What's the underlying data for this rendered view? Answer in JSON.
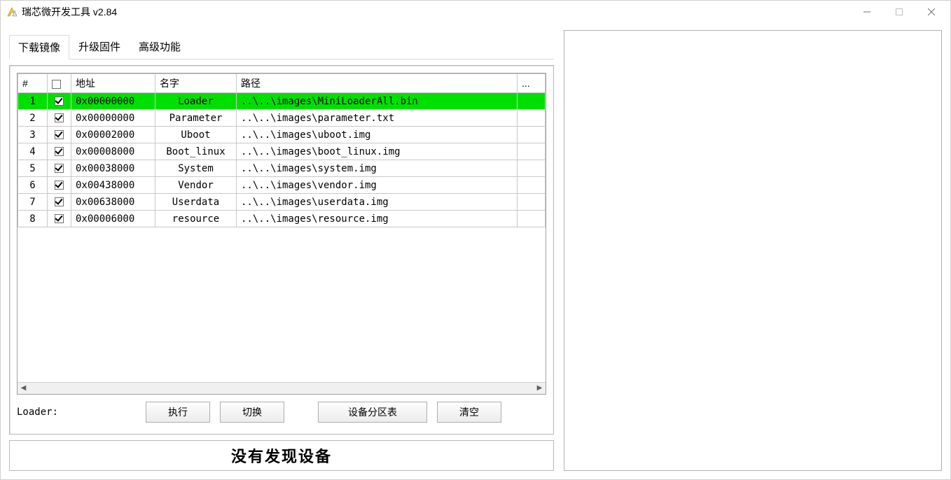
{
  "window": {
    "title": "瑞芯微开发工具 v2.84"
  },
  "tabs": [
    {
      "label": "下载镜像",
      "active": true
    },
    {
      "label": "升级固件",
      "active": false
    },
    {
      "label": "高级功能",
      "active": false
    }
  ],
  "grid": {
    "headers": {
      "index": "#",
      "check": "☐",
      "address": "地址",
      "name": "名字",
      "path": "路径",
      "extra": "..."
    },
    "rows": [
      {
        "idx": "1",
        "checked": true,
        "address": "0x00000000",
        "name": "Loader",
        "path": "..\\..\\images\\MiniLoaderAll.bin",
        "selected": true
      },
      {
        "idx": "2",
        "checked": true,
        "address": "0x00000000",
        "name": "Parameter",
        "path": "..\\..\\images\\parameter.txt",
        "selected": false
      },
      {
        "idx": "3",
        "checked": true,
        "address": "0x00002000",
        "name": "Uboot",
        "path": "..\\..\\images\\uboot.img",
        "selected": false
      },
      {
        "idx": "4",
        "checked": true,
        "address": "0x00008000",
        "name": "Boot_linux",
        "path": "..\\..\\images\\boot_linux.img",
        "selected": false
      },
      {
        "idx": "5",
        "checked": true,
        "address": "0x00038000",
        "name": "System",
        "path": "..\\..\\images\\system.img",
        "selected": false
      },
      {
        "idx": "6",
        "checked": true,
        "address": "0x00438000",
        "name": "Vendor",
        "path": "..\\..\\images\\vendor.img",
        "selected": false
      },
      {
        "idx": "7",
        "checked": true,
        "address": "0x00638000",
        "name": "Userdata",
        "path": "..\\..\\images\\userdata.img",
        "selected": false
      },
      {
        "idx": "8",
        "checked": true,
        "address": "0x00006000",
        "name": "resource",
        "path": "..\\..\\images\\resource.img",
        "selected": false
      }
    ]
  },
  "loader_label": "Loader:",
  "buttons": {
    "execute": "执行",
    "switch": "切换",
    "partition": "设备分区表",
    "clear": "清空"
  },
  "status_text": "没有发现设备"
}
